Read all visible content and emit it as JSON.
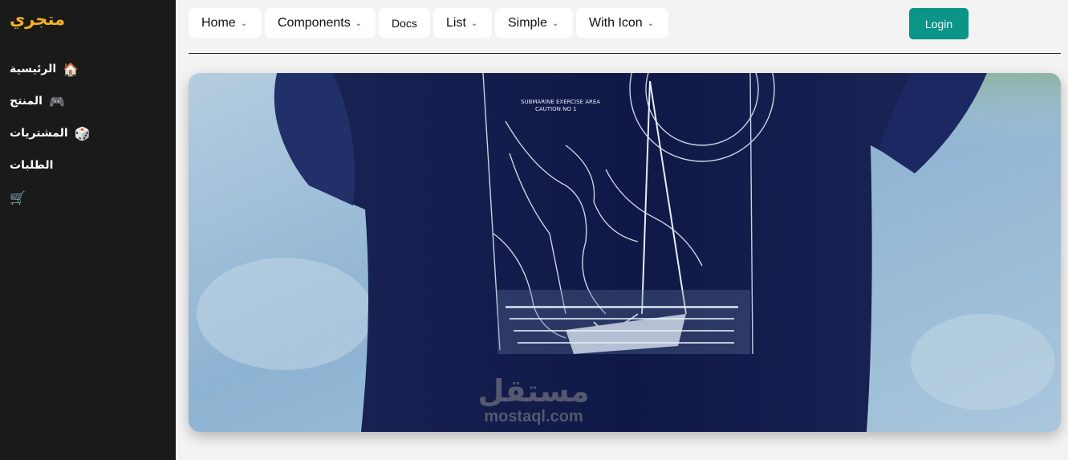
{
  "sidebar": {
    "brand": "متجري",
    "items": [
      {
        "label": "الرئيسية",
        "icon": "🏠"
      },
      {
        "label": "المنتج",
        "icon": "🎮"
      },
      {
        "label": "المشتريات",
        "icon": "🎲"
      },
      {
        "label": "الطلبات",
        "icon": ""
      },
      {
        "label": "",
        "icon": "🛒"
      }
    ]
  },
  "nav": {
    "home": "Home",
    "components": "Components",
    "docs": "Docs",
    "list": "List",
    "simple": "Simple",
    "with_icon": "With Icon",
    "login": "Login"
  },
  "watermark": {
    "logo": "مستقل",
    "site": "mostaql.com"
  },
  "colors": {
    "sidebar_bg": "#1a1a1a",
    "brand": "#f5b21a",
    "login_bg": "#0b9488",
    "page_bg": "#f3f3f3"
  }
}
